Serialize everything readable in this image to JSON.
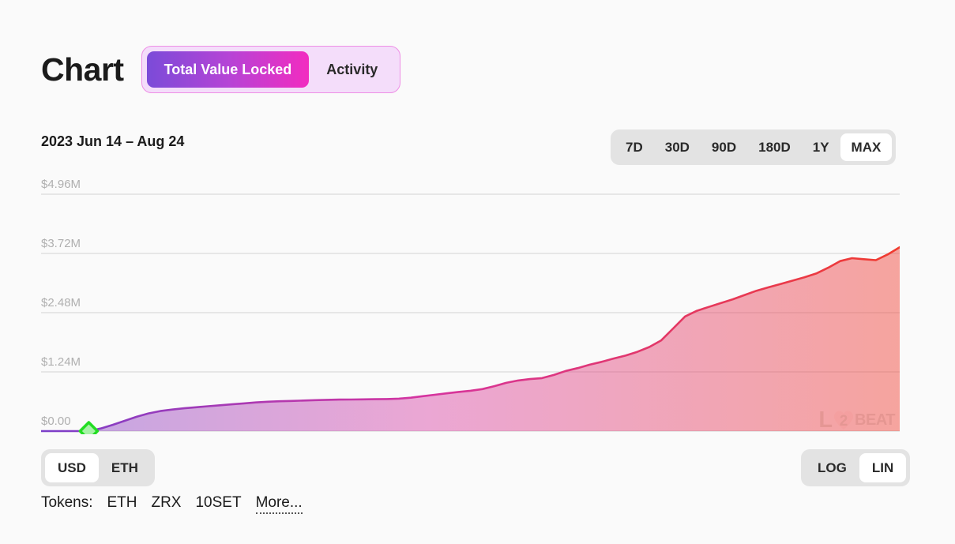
{
  "header": {
    "title": "Chart",
    "tabs": [
      {
        "label": "Total Value Locked",
        "active": true
      },
      {
        "label": "Activity",
        "active": false
      }
    ]
  },
  "subheader": {
    "date_range": "2023 Jun 14 – Aug 24",
    "range_buttons": [
      {
        "label": "7D",
        "active": false
      },
      {
        "label": "30D",
        "active": false
      },
      {
        "label": "90D",
        "active": false
      },
      {
        "label": "180D",
        "active": false
      },
      {
        "label": "1Y",
        "active": false
      },
      {
        "label": "MAX",
        "active": true
      }
    ]
  },
  "footer": {
    "unit_buttons": [
      {
        "label": "USD",
        "active": true
      },
      {
        "label": "ETH",
        "active": false
      }
    ],
    "scale_buttons": [
      {
        "label": "LOG",
        "active": false
      },
      {
        "label": "LIN",
        "active": true
      }
    ],
    "tokens_label": "Tokens:",
    "tokens": [
      "ETH",
      "ZRX",
      "10SET"
    ],
    "more_label": "More..."
  },
  "watermark": {
    "prefix": "L",
    "suffix": "BEAT"
  },
  "colors": {
    "accent_start": "#7B4BD8",
    "accent_end": "#F22CC0",
    "line_start": "#7B3FC9",
    "line_mid": "#D6349F",
    "line_end": "#F03B2E",
    "marker_stroke": "#22DD22",
    "marker_fill": "#A8F2A8",
    "gridline": "#E0E0E0",
    "background": "#FAFAFA",
    "tab_panel": "#F4DDFA",
    "toggle_track": "#E3E3E3"
  },
  "chart_data": {
    "type": "area",
    "title": "Total Value Locked",
    "xlabel": "",
    "ylabel": "USD",
    "grid": true,
    "legend": false,
    "x_range_label": "2023 Jun 14 – Aug 24",
    "ylim": [
      0,
      4960000
    ],
    "ytick_labels": [
      "$0.00",
      "$1.24M",
      "$2.48M",
      "$3.72M",
      "$4.96M"
    ],
    "ytick_values": [
      0,
      1240000,
      2480000,
      3720000,
      4960000
    ],
    "marker": {
      "x_index": 4,
      "value": 0,
      "shape": "diamond",
      "color": "#22DD22"
    },
    "series": [
      {
        "name": "Total Value Locked (USD)",
        "x": [
          0,
          1,
          2,
          3,
          4,
          5,
          6,
          7,
          8,
          9,
          10,
          11,
          12,
          13,
          14,
          15,
          16,
          17,
          18,
          19,
          20,
          21,
          22,
          23,
          24,
          25,
          26,
          27,
          28,
          29,
          30,
          31,
          32,
          33,
          34,
          35,
          36,
          37,
          38,
          39,
          40,
          41,
          42,
          43,
          44,
          45,
          46,
          47,
          48,
          49,
          50,
          51,
          52,
          53,
          54,
          55,
          56,
          57,
          58,
          59,
          60,
          61,
          62,
          63,
          64,
          65,
          66,
          67,
          68,
          69,
          70,
          71,
          72
        ],
        "values": [
          0,
          0,
          0,
          0,
          0,
          55000,
          130000,
          215000,
          300000,
          370000,
          420000,
          452000,
          478000,
          500000,
          520000,
          540000,
          560000,
          580000,
          600000,
          615000,
          625000,
          632000,
          640000,
          648000,
          655000,
          660000,
          662000,
          664000,
          668000,
          672000,
          680000,
          700000,
          730000,
          760000,
          790000,
          820000,
          845000,
          880000,
          940000,
          1010000,
          1060000,
          1090000,
          1110000,
          1175000,
          1260000,
          1320000,
          1390000,
          1450000,
          1520000,
          1580000,
          1660000,
          1760000,
          1900000,
          2150000,
          2400000,
          2520000,
          2600000,
          2680000,
          2760000,
          2850000,
          2940000,
          3010000,
          3080000,
          3150000,
          3220000,
          3300000,
          3420000,
          3560000,
          3620000,
          3600000,
          3580000,
          3700000,
          3850000
        ]
      }
    ]
  }
}
